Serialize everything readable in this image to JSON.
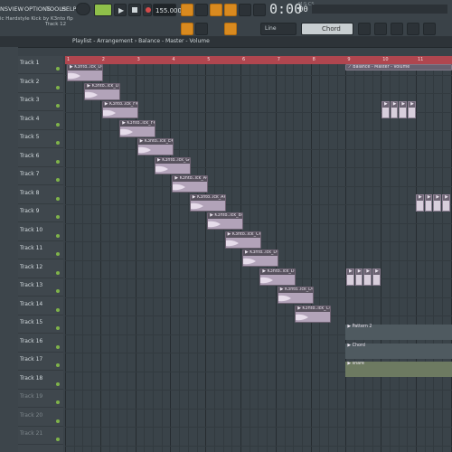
{
  "menu": [
    "NS",
    "VIEW",
    "OPTIONS",
    "TOOLS",
    "HELP"
  ],
  "hint": {
    "line1": "ic Hardstyle Kick by K3nto flp",
    "line2": "Track 12"
  },
  "transport": {
    "tempo": "155.000",
    "time": "0:00",
    "time_small": "00",
    "bst": "M:S:CS",
    "snap": "Line",
    "chord": "Chord"
  },
  "playlist": {
    "breadcrumb": "Playlist - Arrangement › Balance - Master - Volume"
  },
  "ruler": [
    "1",
    "2",
    "3",
    "4",
    "5",
    "6",
    "7",
    "8",
    "9",
    "10",
    "11"
  ],
  "tracks": [
    "Track 1",
    "Track 2",
    "Track 3",
    "Track 4",
    "Track 5",
    "Track 6",
    "Track 7",
    "Track 8",
    "Track 9",
    "Track 10",
    "Track 11",
    "Track 12",
    "Track 13",
    "Track 14",
    "Track 15",
    "Track 16",
    "Track 17",
    "Track 18",
    "Track 19",
    "Track 20",
    "Track 21"
  ],
  "clips": [
    {
      "track": 1,
      "label": "K3nto..ick_D#"
    },
    {
      "track": 2,
      "label": "K3nto..ick_D"
    },
    {
      "track": 3,
      "label": "K3nto..ick_F#"
    },
    {
      "track": 4,
      "label": "K3nto..ick_F#"
    },
    {
      "track": 5,
      "label": "K3nto..ick_E#"
    },
    {
      "track": 6,
      "label": "K3nto..ick_G#"
    },
    {
      "track": 7,
      "label": "K3nto..ick_A#"
    },
    {
      "track": 8,
      "label": "K3nto..ick_A#"
    },
    {
      "track": 9,
      "label": "K3nto..ick_B#"
    },
    {
      "track": 10,
      "label": "K3nto..ick_C#"
    },
    {
      "track": 11,
      "label": "K3nto..ick_D#"
    },
    {
      "track": 12,
      "label": "K3nto..ick_D#"
    },
    {
      "track": 13,
      "label": "K3nto..ick_D#"
    },
    {
      "track": 14,
      "label": "K3nto..ick_C#"
    }
  ],
  "automation": {
    "label": "Balance - Master - Volume"
  },
  "patterns": {
    "p15": "Pattern 2",
    "p16": "Chord",
    "p17": "snare"
  }
}
